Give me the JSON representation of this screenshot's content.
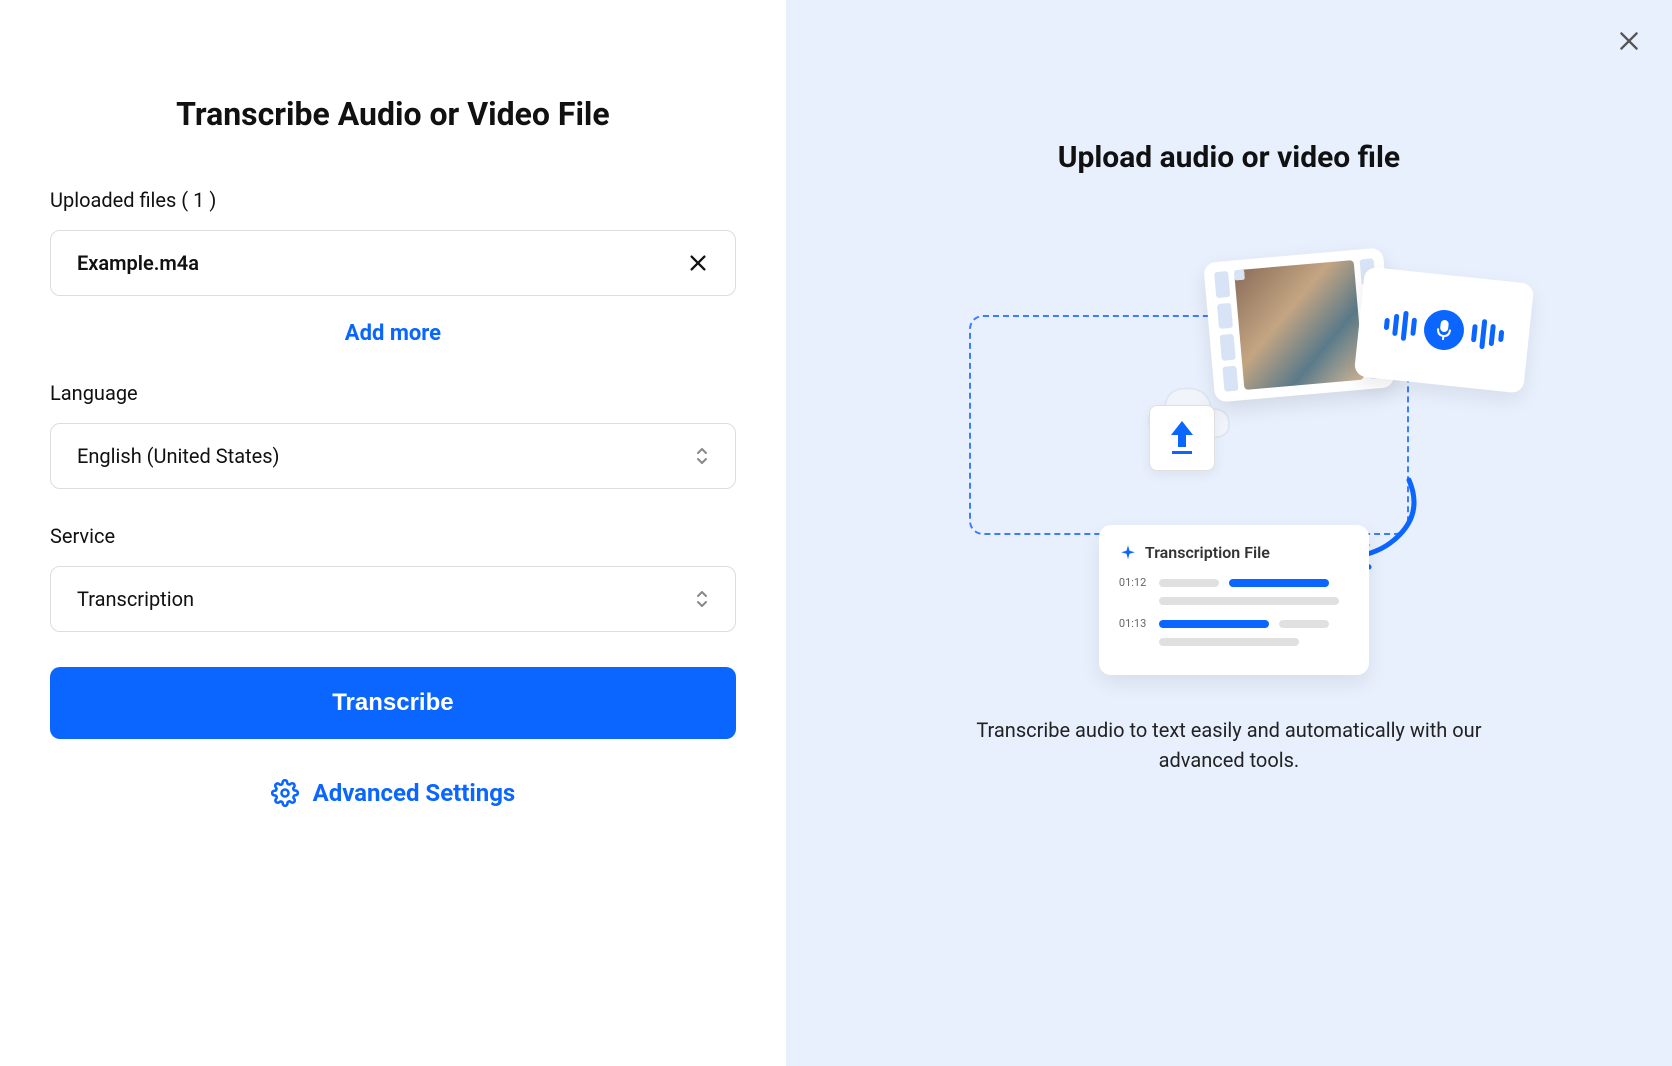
{
  "left": {
    "title": "Transcribe Audio or Video File",
    "uploaded_label": "Uploaded files ( 1 )",
    "file_name": "Example.m4a",
    "add_more": "Add more",
    "language_label": "Language",
    "language_value": "English (United States)",
    "service_label": "Service",
    "service_value": "Transcription",
    "transcribe_btn": "Transcribe",
    "advanced": "Advanced Settings"
  },
  "right": {
    "title": "Upload audio or video file",
    "description": "Transcribe audio to text easily and automatically with our advanced tools.",
    "transcript_card_title": "Transcription File",
    "ts1": "01:12",
    "ts2": "01:13"
  }
}
